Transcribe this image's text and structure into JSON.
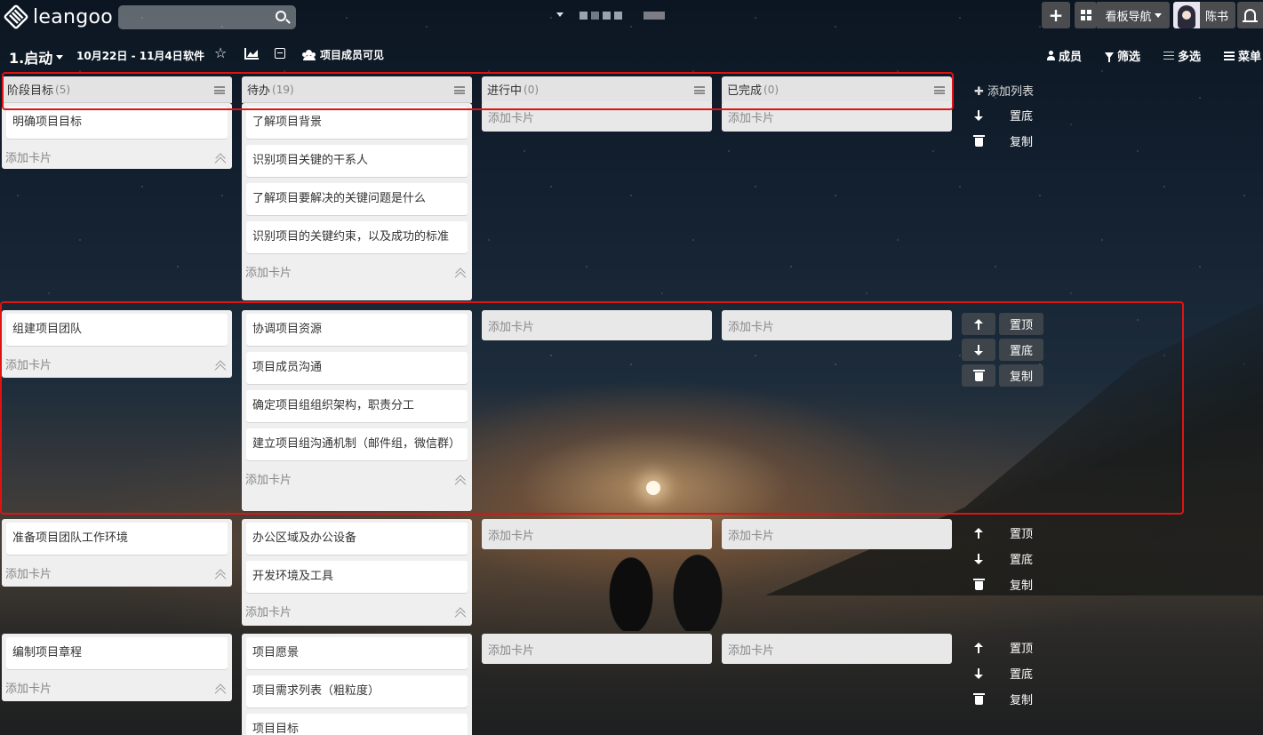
{
  "app": {
    "logo_text": "leangoo",
    "search_placeholder": ""
  },
  "topbar": {
    "plus_label": "+",
    "nav_label": "看板导航",
    "user_name": "陈书"
  },
  "board": {
    "title": "1.启动",
    "date_range": "10月22日 - 11月4日",
    "tag": "软件",
    "star": "☆",
    "visibility": "项目成员可见",
    "right_actions": {
      "members": "成员",
      "filter": "筛选",
      "multi": "多选",
      "menu": "菜单"
    }
  },
  "columns": [
    {
      "name": "阶段目标",
      "count": "(5)"
    },
    {
      "name": "待办",
      "count": "(19)"
    },
    {
      "name": "进行中",
      "count": "(0)"
    },
    {
      "name": "已完成",
      "count": "(0)"
    }
  ],
  "add_card_label": "添加卡片",
  "add_list_label": "添加列表",
  "lane_controls": {
    "top": "置顶",
    "bottom": "置底",
    "copy": "复制"
  },
  "lanes": [
    {
      "goal": [
        "明确项目目标"
      ],
      "todo": [
        "了解项目背景",
        "识别项目关键的干系人",
        "了解项目要解决的关键问题是什么",
        "识别项目的关键约束，以及成功的标准"
      ]
    },
    {
      "goal": [
        "组建项目团队"
      ],
      "todo": [
        "协调项目资源",
        "项目成员沟通",
        "确定项目组组织架构，职责分工",
        "建立项目组沟通机制（邮件组，微信群）"
      ]
    },
    {
      "goal": [
        "准备项目团队工作环境"
      ],
      "todo": [
        "办公区域及办公设备",
        "开发环境及工具"
      ]
    },
    {
      "goal": [
        "编制项目章程"
      ],
      "todo": [
        "项目愿景",
        "项目需求列表（粗粒度）",
        "项目目标"
      ]
    }
  ],
  "colors": {
    "highlight": "#e01313",
    "header_bg": "#e3e3e3",
    "lane_bg": "#efefef"
  }
}
